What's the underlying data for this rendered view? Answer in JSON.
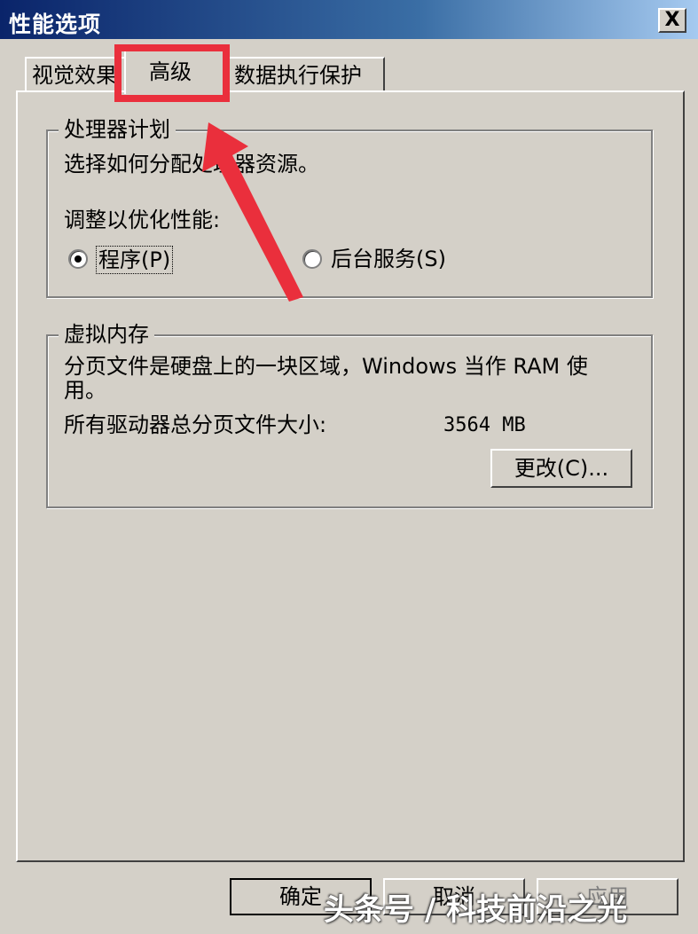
{
  "window": {
    "title": "性能选项",
    "close_label": "X"
  },
  "tabs": [
    {
      "label": "视觉效果"
    },
    {
      "label": "高级"
    },
    {
      "label": "数据执行保护"
    }
  ],
  "processor_scheduling": {
    "group_title": "处理器计划",
    "description": "选择如何分配处理器资源。",
    "adjust_label": "调整以优化性能:",
    "options": [
      {
        "label": "程序(P)",
        "selected": true
      },
      {
        "label": "后台服务(S)",
        "selected": false
      }
    ]
  },
  "virtual_memory": {
    "group_title": "虚拟内存",
    "description_line1": "分页文件是硬盘上的一块区域，Windows 当作 RAM 使",
    "description_line2": "用。",
    "total_label": "所有驱动器总分页文件大小:",
    "total_value": "3564 MB",
    "change_button": "更改(C)..."
  },
  "footer": {
    "ok_button": "确定",
    "cancel_button": "取消",
    "apply_button": "应用"
  },
  "annotation": {
    "highlight_color": "#ea2f3c"
  },
  "watermark": "头条号 / 科技前沿之光"
}
